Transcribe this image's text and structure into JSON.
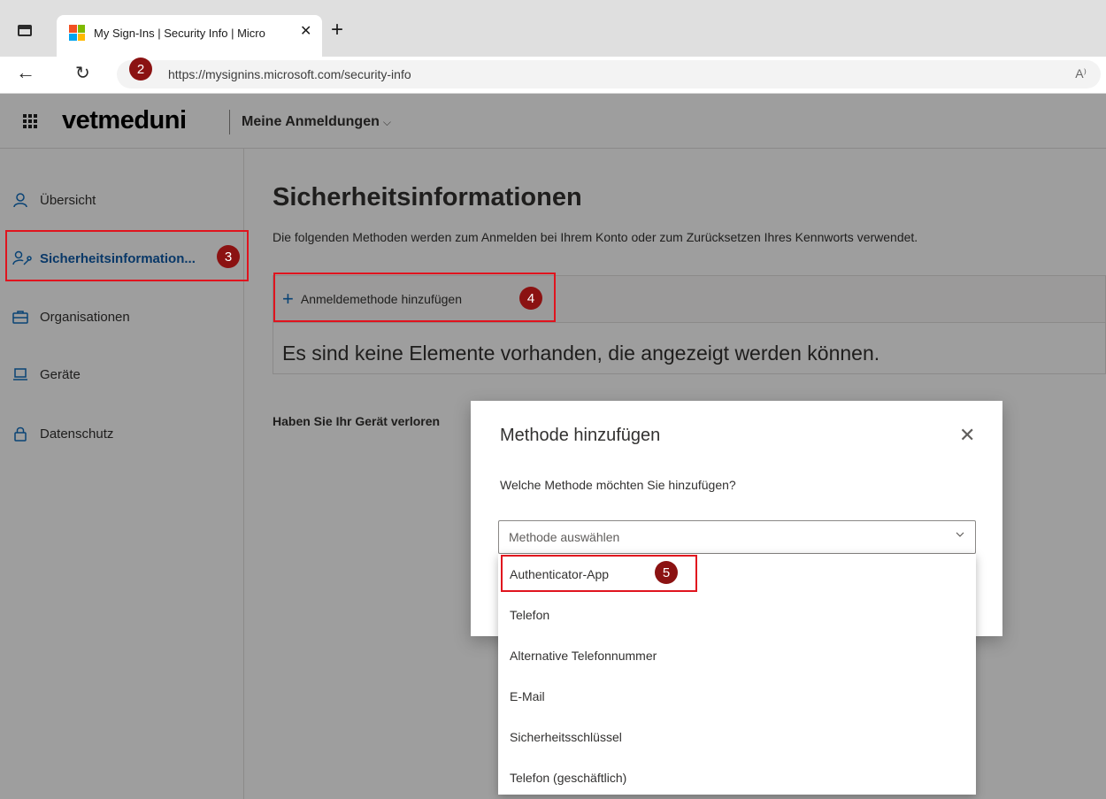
{
  "browser": {
    "tab_title": "My Sign-Ins | Security Info | Micro",
    "tab_close": "✕",
    "new_tab": "+",
    "url": "https://mysignins.microsoft.com/security-info",
    "read_aloud": "A⁾"
  },
  "app": {
    "brand": "vetmeduni",
    "title": "Meine Anmeldungen",
    "title_chevron": "⌵"
  },
  "sidebar": {
    "items": [
      {
        "label": "Übersicht",
        "icon": "person-icon"
      },
      {
        "label": "Sicherheitsinformation...",
        "icon": "person-key-icon"
      },
      {
        "label": "Organisationen",
        "icon": "briefcase-icon"
      },
      {
        "label": "Geräte",
        "icon": "laptop-icon"
      },
      {
        "label": "Datenschutz",
        "icon": "lock-icon"
      }
    ]
  },
  "main": {
    "title": "Sicherheitsinformationen",
    "description": "Die folgenden Methoden werden zum Anmelden bei Ihrem Konto oder zum Zurücksetzen Ihres Kennworts verwendet.",
    "add_method": "Anmeldemethode hinzufügen",
    "empty": "Es sind keine Elemente vorhanden, die angezeigt werden können.",
    "lost_device": "Haben Sie Ihr Gerät verloren"
  },
  "dialog": {
    "title": "Methode hinzufügen",
    "close": "✕",
    "question": "Welche Methode möchten Sie hinzufügen?",
    "select_placeholder": "Methode auswählen",
    "options": [
      "Authenticator-App",
      "Telefon",
      "Alternative Telefonnummer",
      "E-Mail",
      "Sicherheitsschlüssel",
      "Telefon (geschäftlich)"
    ]
  },
  "annotations": {
    "step2": "2",
    "step3": "3",
    "step4": "4",
    "step5": "5",
    "highlight_color": "#e0141e",
    "badge_color": "#8b1212"
  },
  "colors": {
    "accent": "#0f6cbd",
    "ms_logo": [
      "#f25022",
      "#7fba00",
      "#00a4ef",
      "#ffb900"
    ]
  }
}
